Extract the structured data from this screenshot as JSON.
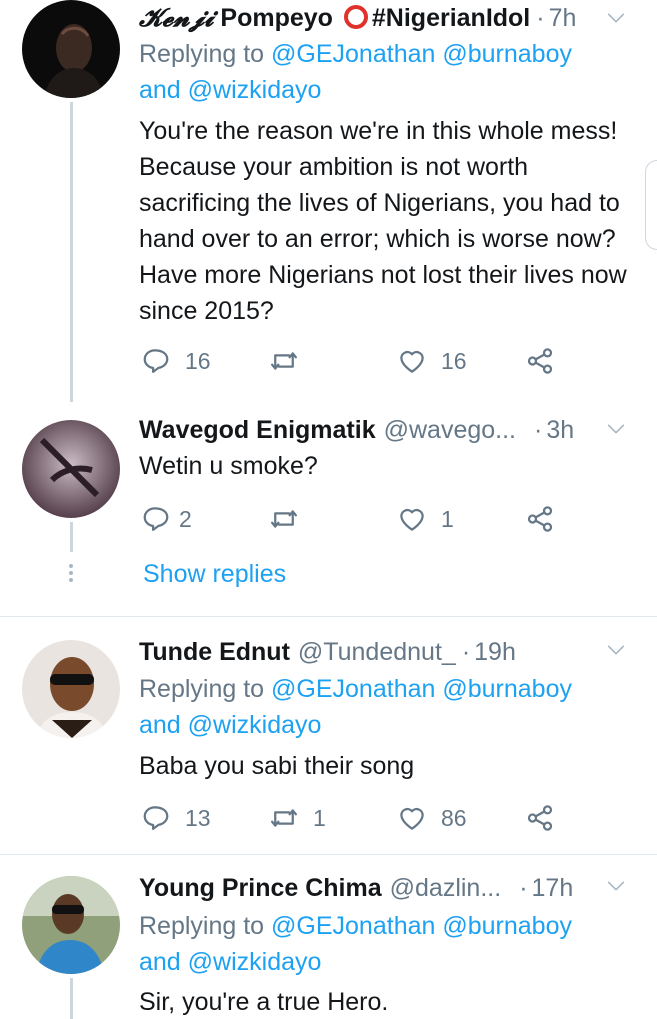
{
  "tweets": [
    {
      "display_name_prefix": "𝓚𝓮𝓷𝓳𝓲",
      "display_name": "Pompeyo",
      "display_name_suffix": "⭕ #NigerianIdol",
      "handle": "",
      "time": "7h",
      "reply_label": "Replying to",
      "reply_mentions": "@GEJonathan @burnaboy",
      "reply_mentions_2": "and @wizkidayo",
      "text": "You're the reason we're  in this whole mess! Because your ambition is not worth sacrificing the lives of Nigerians, you had to hand over to an error; which is worse now? Have more Nigerians not lost their lives now since 2015?",
      "replies": "16",
      "retweets": "",
      "likes": "16"
    },
    {
      "display_name": "Wavegod Enigmatik",
      "handle": "@wavego...",
      "time": "3h",
      "text": "Wetin u smoke?",
      "replies": "2",
      "retweets": "",
      "likes": "1"
    },
    {
      "display_name": "Tunde Ednut",
      "handle": "@Tundednut_",
      "time": "19h",
      "reply_label": "Replying to",
      "reply_mentions": "@GEJonathan @burnaboy",
      "reply_mentions_2": "and @wizkidayo",
      "text": "Baba you sabi their song",
      "replies": "13",
      "retweets": "1",
      "likes": "86"
    },
    {
      "display_name": "Young Prince Chima",
      "handle": "@dazlin...",
      "time": "17h",
      "reply_label": "Replying to",
      "reply_mentions": "@GEJonathan @burnaboy",
      "reply_mentions_2": "and @wizkidayo",
      "text": "Sir, you're a true Hero."
    }
  ],
  "show_replies_label": "Show replies",
  "colors": {
    "link": "#1da1f2",
    "muted": "#657786",
    "divider": "#e1e8ed",
    "thread": "#ccd6dd"
  },
  "icons": [
    "reply-icon",
    "retweet-icon",
    "like-icon",
    "share-icon",
    "chevron-down-icon",
    "red-circle-emoji"
  ]
}
